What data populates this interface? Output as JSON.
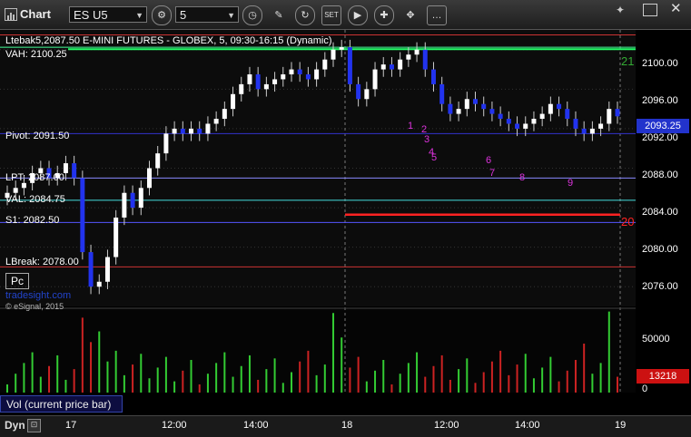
{
  "titlebar": {
    "app_label": "Chart",
    "symbol": "ES U5",
    "interval": "5",
    "icons": [
      "chart-icon",
      "symbol-dropdown",
      "gear-icon",
      "interval-dropdown",
      "clock-icon",
      "pencil-icon",
      "refresh-icon",
      "draw-tool-icon",
      "play-icon",
      "crosshair-icon",
      "chat-icon",
      "pin-icon",
      "maximize-icon",
      "close-icon"
    ]
  },
  "chart": {
    "header": "ES U5, 5, 09:30-16:15 (Dynamic)",
    "header_overlay": "Ltebak5,2087.50 E-MINI FUTURES - GLOBEX, 5, 09:30-16:15 (Dynamic)",
    "watermark": "tradesight.com",
    "copyright": "© eSignal, 2015",
    "pc_button": "Pc",
    "levels": [
      {
        "name": "VAH: 2100.25",
        "value": 2100.25,
        "color": "#44ff99"
      },
      {
        "name": "Pivot: 2091.50",
        "value": 2091.5,
        "color": "#3333cc"
      },
      {
        "name": "LPT: 2087.00",
        "value": 2087.0,
        "color": "#8888ff"
      },
      {
        "name": "VAL: 2084.75",
        "value": 2084.75,
        "color": "#44dddd"
      },
      {
        "name": "S1: 2082.50",
        "value": 2082.5,
        "color": "#5555ff"
      },
      {
        "name": "LBreak: 2078.00",
        "value": 2078.0,
        "color": "#cc3333"
      }
    ],
    "price_ticks": [
      "2100.00",
      "2096.00",
      "2092.00",
      "2088.00",
      "2084.00",
      "2080.00",
      "2076.00"
    ],
    "current_price": "2093.25",
    "marker_21": "21",
    "marker_20": "20",
    "volume_ticks": [
      "50000",
      "0"
    ],
    "current_volume": "13218",
    "vol_label": "Vol (current price bar)",
    "time_ticks": [
      "17",
      "12:00",
      "14:00",
      "18",
      "12:00",
      "14:00",
      "19"
    ],
    "bottom_left": "Dyn",
    "td_labels": [
      "1",
      "2",
      "3",
      "4",
      "5",
      "6",
      "7",
      "8",
      "9"
    ]
  },
  "chart_data": {
    "type": "candlestick",
    "series": [
      {
        "name": "ES U5",
        "ohlc_close": [
          2085.5,
          2086.0,
          2086.5,
          2087.5,
          2088.0,
          2087.0,
          2087.5,
          2088.5,
          2087.0,
          2079.5,
          2076.0,
          2076.5,
          2079.0,
          2083.0,
          2085.5,
          2084.0,
          2086.0,
          2088.0,
          2089.5,
          2091.5,
          2092.0,
          2091.5,
          2092.0,
          2091.5,
          2092.5,
          2093.0,
          2094.0,
          2095.5,
          2096.5,
          2097.5,
          2096.0,
          2096.5,
          2097.0,
          2097.5,
          2098.0,
          2097.5,
          2097.0,
          2098.0,
          2099.0,
          2100.0,
          2100.25,
          2096.5,
          2095.0,
          2096.0,
          2098.0,
          2098.5,
          2098.0,
          2099.0,
          2099.5,
          2100.0,
          2098.0,
          2096.5,
          2094.5,
          2093.5,
          2094.0,
          2095.0,
          2094.5,
          2094.0,
          2093.5,
          2093.0,
          2092.5,
          2092.0,
          2092.5,
          2093.0,
          2093.5,
          2094.5,
          2094.0,
          2093.0,
          2092.0,
          2091.5,
          2092.0,
          2092.5,
          2094.0,
          2093.25
        ]
      }
    ],
    "ylim": [
      2074.0,
      2102.0
    ],
    "vol_ylim": [
      0,
      80000
    ]
  }
}
